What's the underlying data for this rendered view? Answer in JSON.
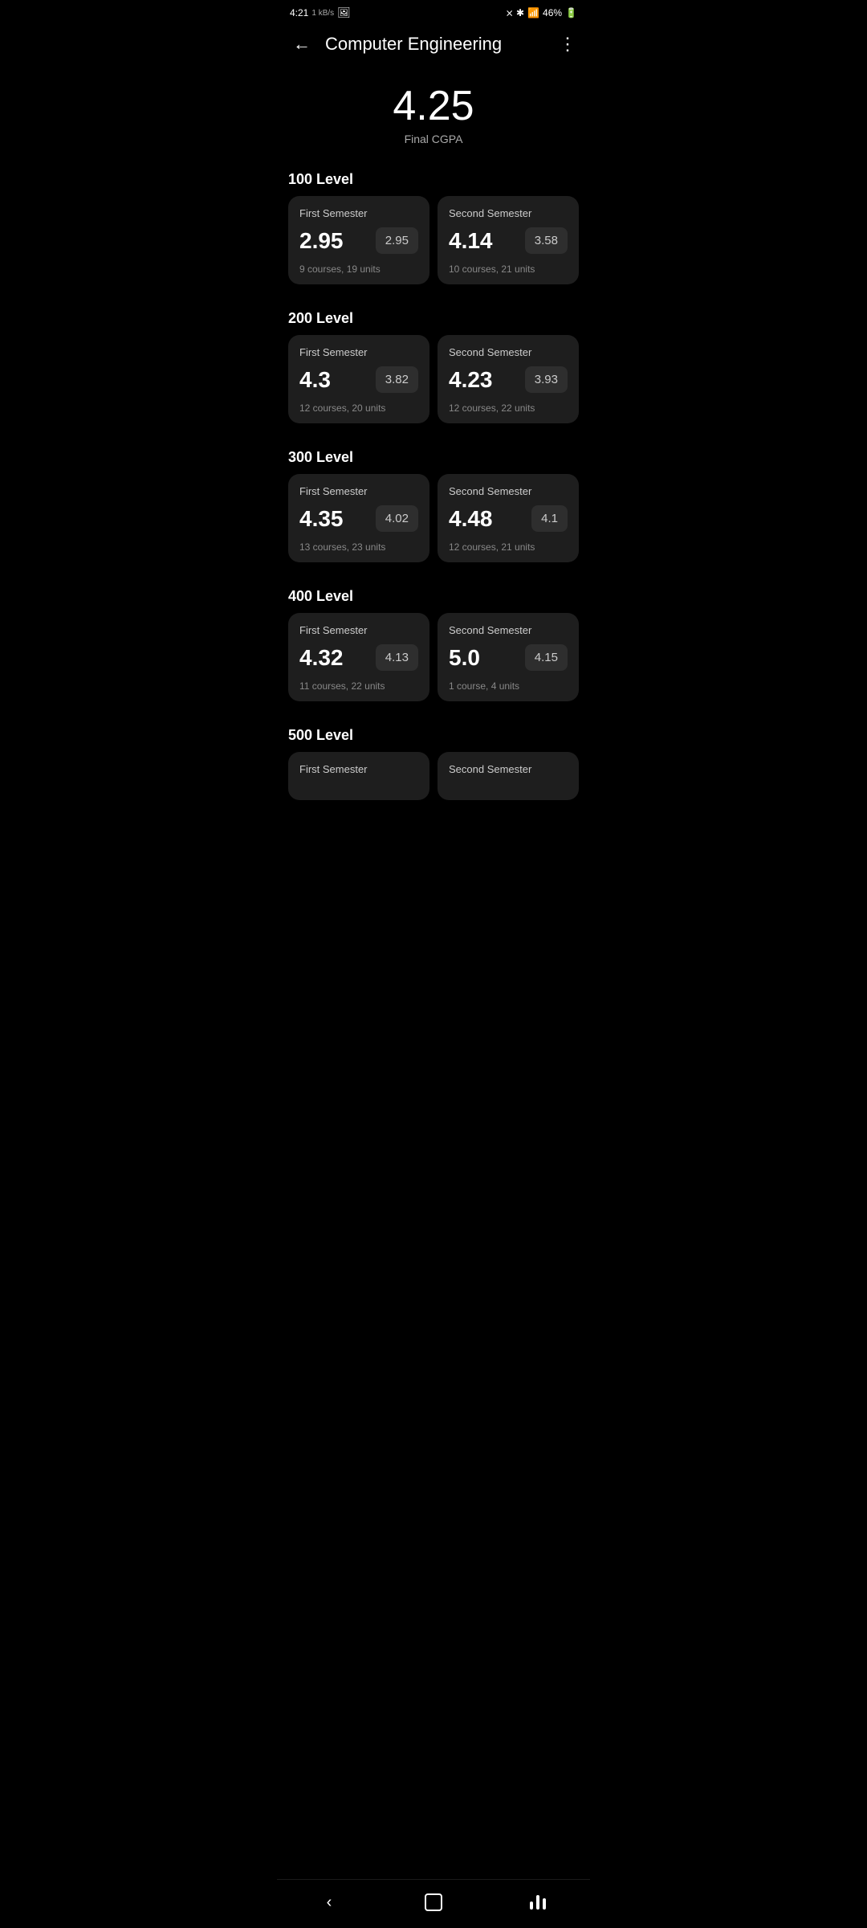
{
  "statusBar": {
    "time": "4:21",
    "signal": "46%"
  },
  "header": {
    "title": "Computer Engineering",
    "backLabel": "←",
    "moreLabel": "⋮"
  },
  "cgpa": {
    "value": "4.25",
    "label": "Final CGPA"
  },
  "levels": [
    {
      "heading": "100 Level",
      "semesters": [
        {
          "title": "First Semester",
          "gpa": "2.95",
          "cgpa": "2.95",
          "courses": "9 courses, 19 units"
        },
        {
          "title": "Second Semester",
          "gpa": "4.14",
          "cgpa": "3.58",
          "courses": "10 courses, 21 units"
        }
      ]
    },
    {
      "heading": "200 Level",
      "semesters": [
        {
          "title": "First Semester",
          "gpa": "4.3",
          "cgpa": "3.82",
          "courses": "12 courses, 20 units"
        },
        {
          "title": "Second Semester",
          "gpa": "4.23",
          "cgpa": "3.93",
          "courses": "12 courses, 22 units"
        }
      ]
    },
    {
      "heading": "300 Level",
      "semesters": [
        {
          "title": "First Semester",
          "gpa": "4.35",
          "cgpa": "4.02",
          "courses": "13 courses, 23 units"
        },
        {
          "title": "Second Semester",
          "gpa": "4.48",
          "cgpa": "4.1",
          "courses": "12 courses, 21 units"
        }
      ]
    },
    {
      "heading": "400 Level",
      "semesters": [
        {
          "title": "First Semester",
          "gpa": "4.32",
          "cgpa": "4.13",
          "courses": "11 courses, 22 units"
        },
        {
          "title": "Second Semester",
          "gpa": "5.0",
          "cgpa": "4.15",
          "courses": "1 course, 4 units"
        }
      ]
    },
    {
      "heading": "500 Level",
      "semesters": [
        {
          "title": "First Semester",
          "gpa": "",
          "cgpa": "",
          "courses": ""
        },
        {
          "title": "Second Semester",
          "gpa": "",
          "cgpa": "",
          "courses": ""
        }
      ]
    }
  ],
  "bottomNav": {
    "back": "<",
    "home": "○",
    "recent": "|||"
  }
}
